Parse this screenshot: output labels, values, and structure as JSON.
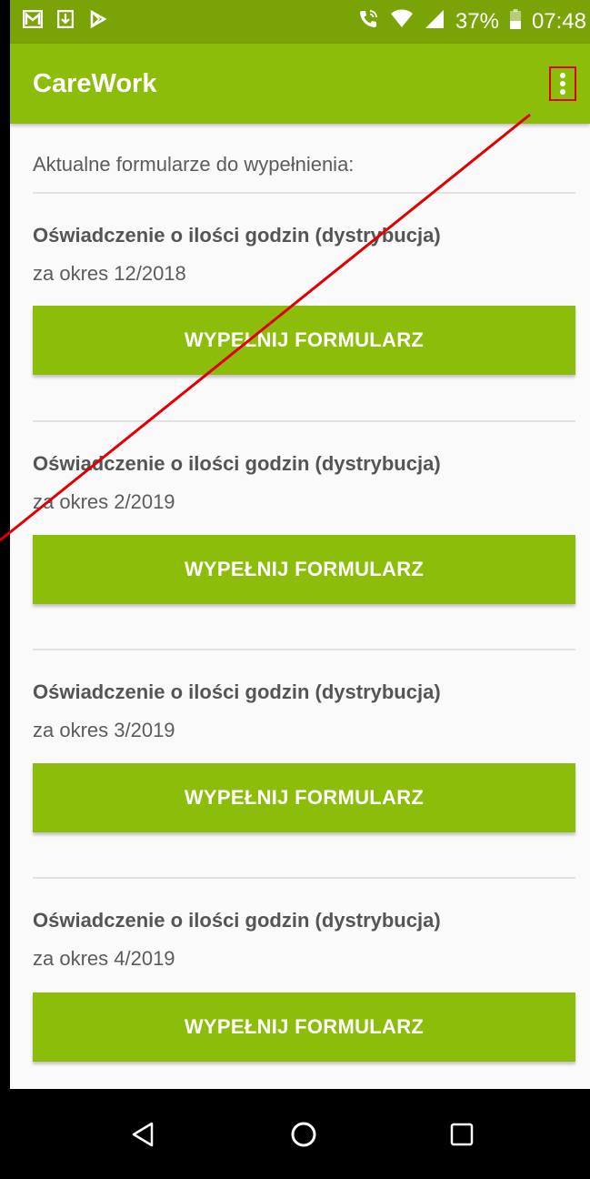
{
  "status_bar": {
    "notification_icons": [
      "gmail-icon",
      "download-icon",
      "play-store-icon"
    ],
    "battery": "37%",
    "time": "07:48"
  },
  "app_bar": {
    "title": "CareWork",
    "menu_icon": "more-vert-icon"
  },
  "content": {
    "intro": "Aktualne formularze do wypełnienia:",
    "forms": [
      {
        "title": "Oświadczenie o ilości godzin (dystrybucja)",
        "period": "za okres 12/2018",
        "button": "WYPEŁNIJ FORMULARZ"
      },
      {
        "title": "Oświadczenie o ilości godzin (dystrybucja)",
        "period": "za okres 2/2019",
        "button": "WYPEŁNIJ FORMULARZ"
      },
      {
        "title": "Oświadczenie o ilości godzin (dystrybucja)",
        "period": "za okres 3/2019",
        "button": "WYPEŁNIJ FORMULARZ"
      },
      {
        "title": "Oświadczenie o ilości godzin (dystrybucja)",
        "period": "za okres 4/2019",
        "button": "WYPEŁNIJ FORMULARZ"
      }
    ]
  },
  "nav_bar": {
    "buttons": [
      "back-icon",
      "home-icon",
      "recents-icon"
    ]
  },
  "colors": {
    "status_bar": "#7aa307",
    "app_bar": "#8cbd0a",
    "button": "#8cbd0a",
    "annotation": "#e00000"
  }
}
